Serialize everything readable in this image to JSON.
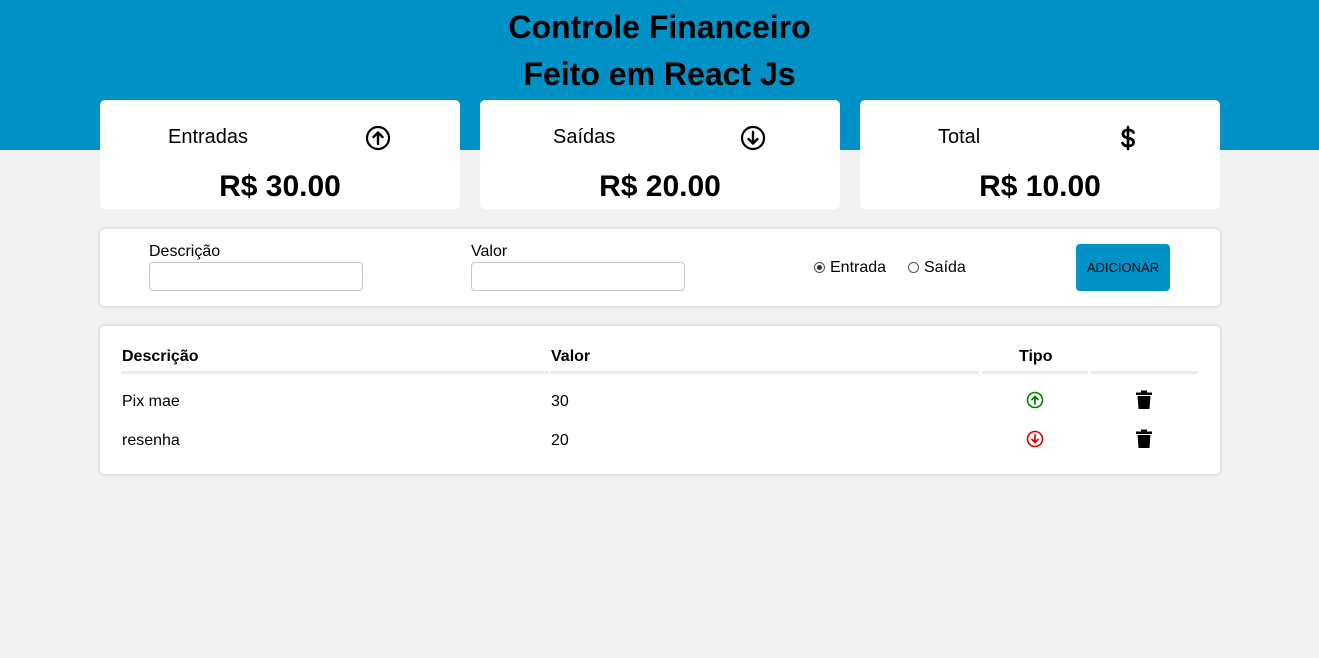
{
  "header": {
    "title": "Controle Financeiro",
    "subtitle": "Feito em React Js",
    "color": "#0091c6"
  },
  "summary": {
    "entradas": {
      "title": "Entradas",
      "value": "R$ 30.00",
      "icon": "arrow-up-circle-icon"
    },
    "saidas": {
      "title": "Saídas",
      "value": "R$ 20.00",
      "icon": "arrow-down-circle-icon"
    },
    "total": {
      "title": "Total",
      "value": "R$ 10.00",
      "icon": "dollar-icon"
    }
  },
  "form": {
    "descricao_label": "Descrição",
    "descricao_value": "",
    "valor_label": "Valor",
    "valor_value": "",
    "radio_entrada": "Entrada",
    "radio_saida": "Saída",
    "selected": "Entrada",
    "button_label": "ADICIONAR"
  },
  "table": {
    "headers": {
      "descricao": "Descrição",
      "valor": "Valor",
      "tipo": "Tipo"
    },
    "rows": [
      {
        "descricao": "Pix mae",
        "valor": "30",
        "tipo": "entrada",
        "tipo_icon": "arrow-up-circle-icon",
        "tipo_color": "#008000"
      },
      {
        "descricao": "resenha",
        "valor": "20",
        "tipo": "saida",
        "tipo_icon": "arrow-down-circle-icon",
        "tipo_color": "#e00000"
      }
    ]
  }
}
